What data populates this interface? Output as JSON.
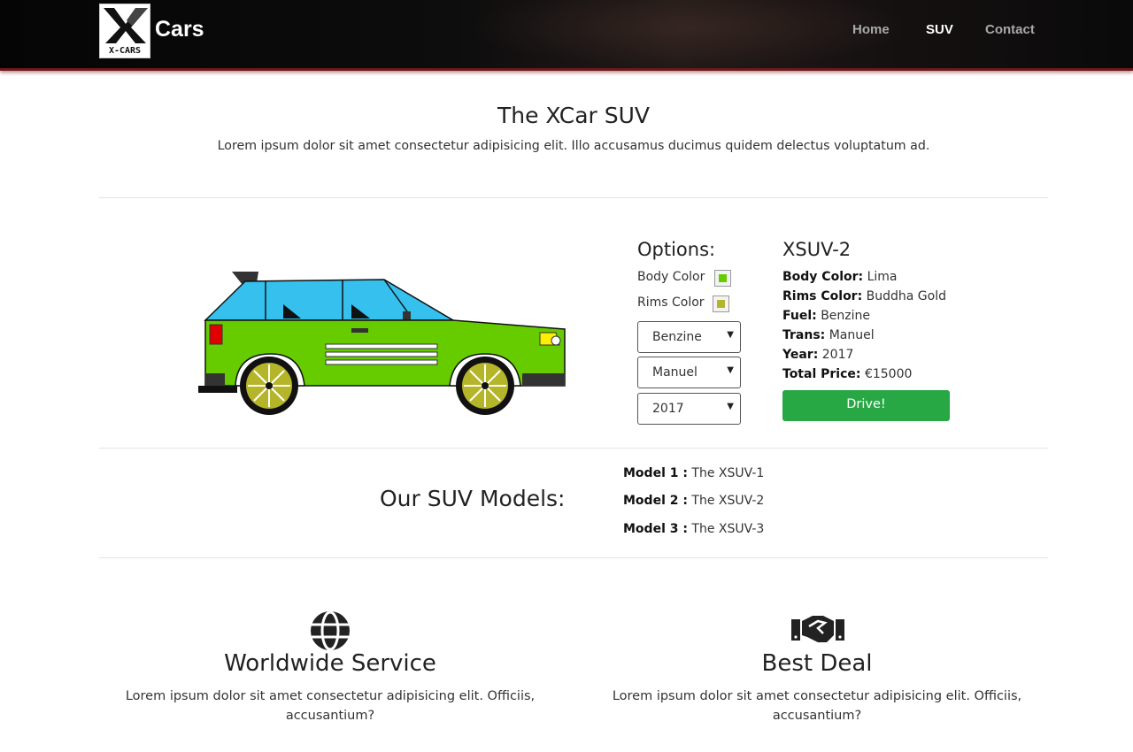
{
  "nav": {
    "logo_caption": "X-CARS",
    "brand": "Cars",
    "links": [
      {
        "label": "Home",
        "active": false
      },
      {
        "label": "SUV",
        "active": true
      },
      {
        "label": "Contact",
        "active": false
      }
    ]
  },
  "hero": {
    "title": "The XCar SUV",
    "intro": "Lorem ipsum dolor sit amet consectetur adipisicing elit. Illo accusamus ducimus quidem delectus voluptatum ad."
  },
  "car": {
    "body_color": "#66cc00",
    "window_color": "#35c0ee",
    "rim_color": "#b5b52a"
  },
  "options": {
    "title": "Options:",
    "body_color_label": "Body Color",
    "body_color_swatch": "#66cc00",
    "rims_color_label": "Rims Color",
    "rims_color_swatch": "#b5b52a",
    "fuel_select": "Benzine",
    "trans_select": "Manuel",
    "year_select": "2017"
  },
  "specs": {
    "model": "XSUV-2",
    "rows": [
      {
        "label": "Body Color:",
        "value": "Lima"
      },
      {
        "label": "Rims Color:",
        "value": "Buddha Gold"
      },
      {
        "label": "Fuel:",
        "value": "Benzine"
      },
      {
        "label": "Trans:",
        "value": "Manuel"
      },
      {
        "label": "Year:",
        "value": "2017"
      },
      {
        "label": "Total Price:",
        "value": "€15000"
      }
    ],
    "button": "Drive!",
    "button_color": "#28a745"
  },
  "models": {
    "title": "Our SUV Models:",
    "items": [
      {
        "label": "Model 1 :",
        "value": "The XSUV-1"
      },
      {
        "label": "Model 2 :",
        "value": "The XSUV-2"
      },
      {
        "label": "Model 3 :",
        "value": "The XSUV-3"
      }
    ]
  },
  "features": [
    {
      "icon": "globe-icon",
      "title": "Worldwide Service",
      "text_line1": "Lorem ipsum dolor sit amet consectetur adipisicing elit. Officiis,",
      "text_line2": "accusantium?"
    },
    {
      "icon": "handshake-icon",
      "title": "Best Deal",
      "text_line1": "Lorem ipsum dolor sit amet consectetur adipisicing elit. Officiis,",
      "text_line2": "accusantium?"
    }
  ]
}
